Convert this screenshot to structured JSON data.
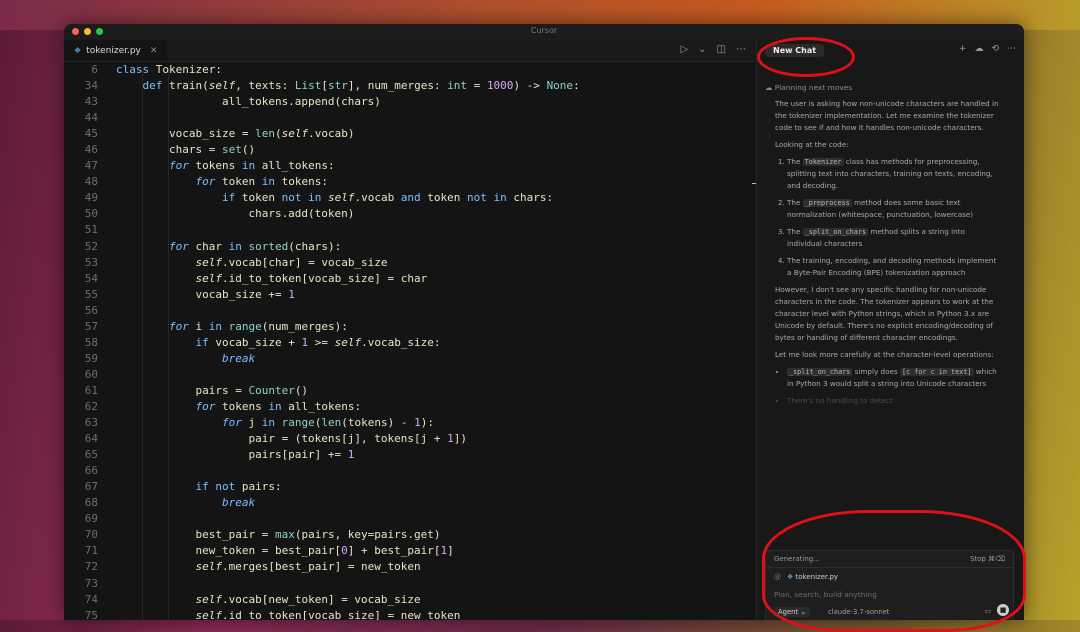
{
  "window": {
    "title": "Cursor"
  },
  "editor": {
    "tab": {
      "filename": "tokenizer.py",
      "close_glyph": "✕"
    },
    "actions": [
      "▷",
      "⌄",
      "◫",
      "⋯"
    ],
    "lines": [
      {
        "n": "6",
        "code": "class Tokenizer:"
      },
      {
        "n": "34",
        "code": "    def train(self, texts: List[str], num_merges: int = 1000) -> None:"
      },
      {
        "n": "43",
        "code": "                all_tokens.append(chars)"
      },
      {
        "n": "44",
        "code": ""
      },
      {
        "n": "45",
        "code": "        vocab_size = len(self.vocab)"
      },
      {
        "n": "46",
        "code": "        chars = set()"
      },
      {
        "n": "47",
        "code": "        for tokens in all_tokens:"
      },
      {
        "n": "48",
        "code": "            for token in tokens:"
      },
      {
        "n": "49",
        "code": "                if token not in self.vocab and token not in chars:"
      },
      {
        "n": "50",
        "code": "                    chars.add(token)"
      },
      {
        "n": "51",
        "code": ""
      },
      {
        "n": "52",
        "code": "        for char in sorted(chars):"
      },
      {
        "n": "53",
        "code": "            self.vocab[char] = vocab_size"
      },
      {
        "n": "54",
        "code": "            self.id_to_token[vocab_size] = char"
      },
      {
        "n": "55",
        "code": "            vocab_size += 1"
      },
      {
        "n": "56",
        "code": ""
      },
      {
        "n": "57",
        "code": "        for i in range(num_merges):"
      },
      {
        "n": "58",
        "code": "            if vocab_size + 1 >= self.vocab_size:"
      },
      {
        "n": "59",
        "code": "                break"
      },
      {
        "n": "60",
        "code": ""
      },
      {
        "n": "61",
        "code": "            pairs = Counter()"
      },
      {
        "n": "62",
        "code": "            for tokens in all_tokens:"
      },
      {
        "n": "63",
        "code": "                for j in range(len(tokens) - 1):"
      },
      {
        "n": "64",
        "code": "                    pair = (tokens[j], tokens[j + 1])"
      },
      {
        "n": "65",
        "code": "                    pairs[pair] += 1"
      },
      {
        "n": "66",
        "code": ""
      },
      {
        "n": "67",
        "code": "            if not pairs:"
      },
      {
        "n": "68",
        "code": "                break"
      },
      {
        "n": "69",
        "code": ""
      },
      {
        "n": "70",
        "code": "            best_pair = max(pairs, key=pairs.get)"
      },
      {
        "n": "71",
        "code": "            new_token = best_pair[0] + best_pair[1]"
      },
      {
        "n": "72",
        "code": "            self.merges[best_pair] = new_token"
      },
      {
        "n": "73",
        "code": ""
      },
      {
        "n": "74",
        "code": "            self.vocab[new_token] = vocab_size"
      },
      {
        "n": "75",
        "code": "            self.id_to_token[vocab_size] = new_token"
      }
    ]
  },
  "chat": {
    "new_chat_label": "New Chat",
    "icons": [
      "+",
      "☁",
      "⟲",
      "⋯"
    ],
    "planning": "Planning next moves",
    "intro": "The user is asking how non-unicode characters are handled in the tokenizer implementation. Let me examine the tokenizer code to see if and how it handles non-unicode characters.",
    "looking": "Looking at the code:",
    "points": [
      {
        "pre": "The ",
        "chip": "Tokenizer",
        "post": " class has methods for preprocessing, splitting text into characters, training on texts, encoding, and decoding."
      },
      {
        "pre": "The ",
        "chip": "_preprocess",
        "post": " method does some basic text normalization (whitespace, punctuation, lowercase)"
      },
      {
        "pre": "The ",
        "chip": "_split_on_chars",
        "post": " method splits a string into individual characters"
      },
      {
        "pre": "",
        "chip": "",
        "post": "The training, encoding, and decoding methods implement a Byte-Pair Encoding (BPE) tokenization approach"
      }
    ],
    "however": "However, I don't see any specific handling for non-unicode characters in the code. The tokenizer appears to work at the character level with Python strings, which in Python 3.x are Unicode by default. There's no explicit encoding/decoding of bytes or handling of different character encodings.",
    "look_more": "Let me look more carefully at the character-level operations:",
    "bullet": {
      "chip1": "_split_on_chars",
      "mid": " simply does ",
      "chip2": "[c for c in text]",
      "post": " which in Python 3 would split a string into Unicode characters"
    },
    "faded": "There's no handling to detect",
    "composer": {
      "status": "Generating...",
      "stop": "Stop ⌘⌫",
      "file": "tokenizer.py",
      "at_glyph": "@",
      "placeholder": "Plan, search, build anything",
      "mode": "Agent ⌄",
      "model": "claude-3.7-sonnet",
      "image_icon": "▭",
      "send_icon": "■"
    }
  }
}
